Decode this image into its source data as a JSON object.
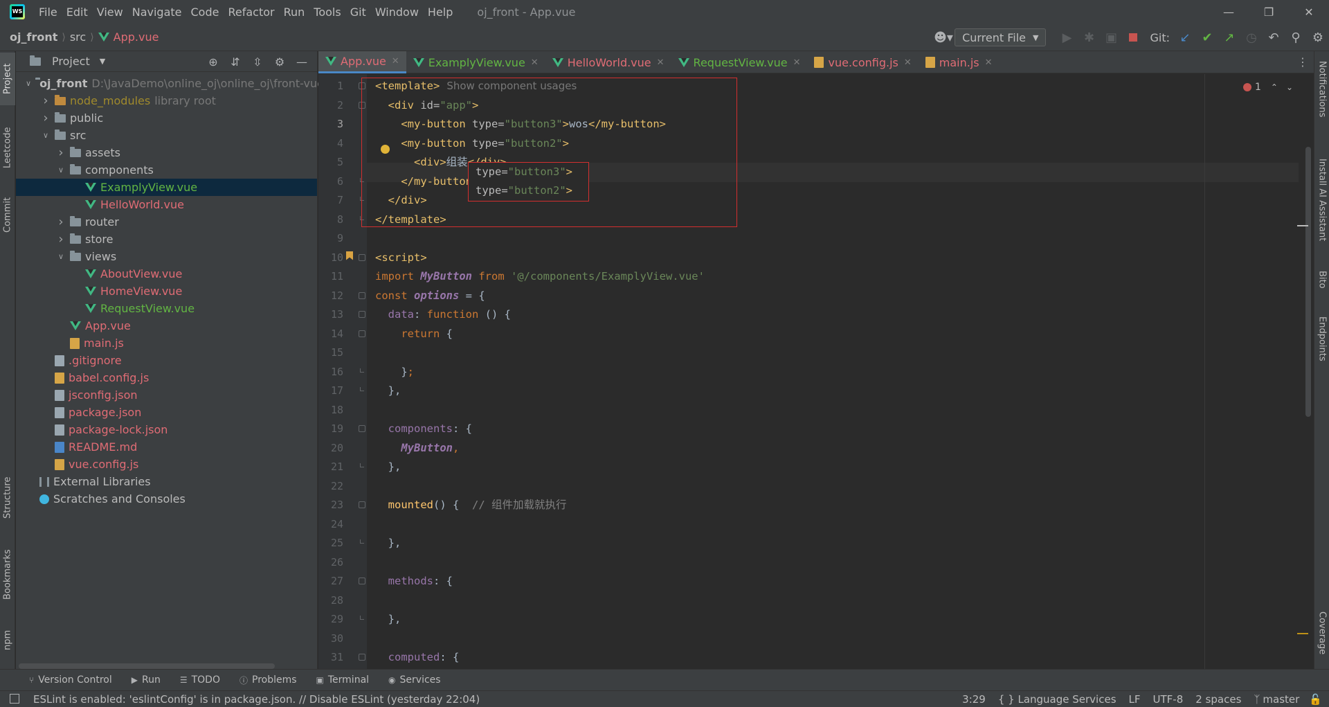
{
  "menubar": {
    "items": [
      "File",
      "Edit",
      "View",
      "Navigate",
      "Code",
      "Refactor",
      "Run",
      "Tools",
      "Git",
      "Window",
      "Help"
    ],
    "window_title": "oj_front - App.vue"
  },
  "navbar": {
    "project": "oj_front",
    "folder": "src",
    "file": "App.vue",
    "run_config": "Current File",
    "git_label": "Git:"
  },
  "left_tool_windows": [
    "Project",
    "Leetcode",
    "Commit",
    "Structure",
    "Bookmarks",
    "npm"
  ],
  "right_tool_windows": [
    "Notifications",
    "Install AI Assistant",
    "Bito",
    "Endpoints",
    "Coverage"
  ],
  "project_panel": {
    "title": "Project",
    "tree": [
      {
        "indent": 0,
        "arrow": "down",
        "icon": "folder",
        "label": "oj_front",
        "hint": "D:\\JavaDemo\\online_oj\\online_oj\\front-vue",
        "color": "bold"
      },
      {
        "indent": 1,
        "arrow": "right",
        "icon": "folder-nm",
        "label": "node_modules",
        "hint": "library root",
        "color": "olive"
      },
      {
        "indent": 1,
        "arrow": "right",
        "icon": "folder",
        "label": "public",
        "hint": "",
        "color": "normal"
      },
      {
        "indent": 1,
        "arrow": "down",
        "icon": "folder",
        "label": "src",
        "hint": "",
        "color": "normal"
      },
      {
        "indent": 2,
        "arrow": "right",
        "icon": "folder",
        "label": "assets",
        "hint": "",
        "color": "normal"
      },
      {
        "indent": 2,
        "arrow": "down",
        "icon": "folder",
        "label": "components",
        "hint": "",
        "color": "normal"
      },
      {
        "indent": 3,
        "arrow": "",
        "icon": "vue",
        "label": "ExamplyView.vue",
        "hint": "",
        "color": "green",
        "selected": true
      },
      {
        "indent": 3,
        "arrow": "",
        "icon": "vue",
        "label": "HelloWorld.vue",
        "hint": "",
        "color": "red"
      },
      {
        "indent": 2,
        "arrow": "right",
        "icon": "folder",
        "label": "router",
        "hint": "",
        "color": "normal"
      },
      {
        "indent": 2,
        "arrow": "right",
        "icon": "folder",
        "label": "store",
        "hint": "",
        "color": "normal"
      },
      {
        "indent": 2,
        "arrow": "down",
        "icon": "folder",
        "label": "views",
        "hint": "",
        "color": "normal"
      },
      {
        "indent": 3,
        "arrow": "",
        "icon": "vue",
        "label": "AboutView.vue",
        "hint": "",
        "color": "red"
      },
      {
        "indent": 3,
        "arrow": "",
        "icon": "vue",
        "label": "HomeView.vue",
        "hint": "",
        "color": "red"
      },
      {
        "indent": 3,
        "arrow": "",
        "icon": "vue",
        "label": "RequestView.vue",
        "hint": "",
        "color": "green"
      },
      {
        "indent": 2,
        "arrow": "",
        "icon": "vue",
        "label": "App.vue",
        "hint": "",
        "color": "red"
      },
      {
        "indent": 2,
        "arrow": "",
        "icon": "js",
        "label": "main.js",
        "hint": "",
        "color": "red"
      },
      {
        "indent": 1,
        "arrow": "",
        "icon": "file",
        "label": ".gitignore",
        "hint": "",
        "color": "red"
      },
      {
        "indent": 1,
        "arrow": "",
        "icon": "js",
        "label": "babel.config.js",
        "hint": "",
        "color": "red"
      },
      {
        "indent": 1,
        "arrow": "",
        "icon": "json",
        "label": "jsconfig.json",
        "hint": "",
        "color": "red"
      },
      {
        "indent": 1,
        "arrow": "",
        "icon": "json",
        "label": "package.json",
        "hint": "",
        "color": "red"
      },
      {
        "indent": 1,
        "arrow": "",
        "icon": "json",
        "label": "package-lock.json",
        "hint": "",
        "color": "red"
      },
      {
        "indent": 1,
        "arrow": "",
        "icon": "md",
        "label": "README.md",
        "hint": "",
        "color": "red"
      },
      {
        "indent": 1,
        "arrow": "",
        "icon": "js",
        "label": "vue.config.js",
        "hint": "",
        "color": "red"
      },
      {
        "indent": 0,
        "arrow": "",
        "icon": "libs",
        "label": "External Libraries",
        "hint": "",
        "color": "normal"
      },
      {
        "indent": 0,
        "arrow": "",
        "icon": "scratch",
        "label": "Scratches and Consoles",
        "hint": "",
        "color": "normal"
      }
    ]
  },
  "tabs": [
    {
      "label": "App.vue",
      "icon": "vue",
      "color": "red",
      "active": true
    },
    {
      "label": "ExamplyView.vue",
      "icon": "vue",
      "color": "green",
      "active": false
    },
    {
      "label": "HelloWorld.vue",
      "icon": "vue",
      "color": "red",
      "active": false
    },
    {
      "label": "RequestView.vue",
      "icon": "vue",
      "color": "green",
      "active": false
    },
    {
      "label": "vue.config.js",
      "icon": "js",
      "color": "red",
      "active": false
    },
    {
      "label": "main.js",
      "icon": "js",
      "color": "red",
      "active": false
    }
  ],
  "editor": {
    "error_count": "1",
    "popup_lines": [
      "type=\"button3\">",
      "type=\"button2\">"
    ],
    "usage_hint": "Show component usages",
    "lines": [
      [
        [
          "t-tag",
          "<template>"
        ]
      ],
      [
        [
          "",
          "  "
        ],
        [
          "t-tag",
          "<div "
        ],
        [
          "t-attr",
          "id="
        ],
        [
          "t-str",
          "\"app\""
        ],
        [
          "t-tag",
          ">"
        ]
      ],
      [
        [
          "",
          "    "
        ],
        [
          "t-tag",
          "<my-button "
        ],
        [
          "t-attr",
          "type="
        ],
        [
          "t-str",
          "\"button3\""
        ],
        [
          "t-tag",
          ">"
        ],
        [
          "",
          "wos"
        ],
        [
          "t-tag",
          "</my-button>"
        ]
      ],
      [
        [
          "",
          "    "
        ],
        [
          "t-tag",
          "<my-button "
        ],
        [
          "t-attr",
          "type="
        ],
        [
          "t-str",
          "\"button2\""
        ],
        [
          "t-tag",
          ">"
        ]
      ],
      [
        [
          "",
          "      "
        ],
        [
          "t-tag",
          "<div>"
        ],
        [
          "",
          "组装"
        ],
        [
          "t-tag",
          "</div>"
        ]
      ],
      [
        [
          "",
          "    "
        ],
        [
          "t-tag",
          "</my-button>"
        ]
      ],
      [
        [
          "",
          "  "
        ],
        [
          "t-tag",
          "</div>"
        ]
      ],
      [
        [
          "t-tag",
          "</template>"
        ]
      ],
      [],
      [
        [
          "t-tag",
          "<script>"
        ]
      ],
      [
        [
          "t-kw",
          "import "
        ],
        [
          "t-cls",
          "MyButton "
        ],
        [
          "t-kw",
          "from "
        ],
        [
          "t-str",
          "'@/components/ExamplyView.vue'"
        ]
      ],
      [
        [
          "t-kw",
          "const "
        ],
        [
          "t-cls",
          "options "
        ],
        [
          "",
          "= {"
        ]
      ],
      [
        [
          "",
          "  "
        ],
        [
          "t-prop",
          "data"
        ],
        [
          "",
          ": "
        ],
        [
          "t-kw",
          "function "
        ],
        [
          "",
          "() {"
        ]
      ],
      [
        [
          "",
          "    "
        ],
        [
          "t-kw",
          "return "
        ],
        [
          "",
          "{"
        ]
      ],
      [],
      [
        [
          "",
          "    "
        ],
        [
          "",
          "}"
        ],
        [
          "t-kw",
          ";"
        ]
      ],
      [
        [
          "",
          "  "
        ],
        [
          "",
          "},"
        ]
      ],
      [],
      [
        [
          "",
          "  "
        ],
        [
          "t-prop",
          "components"
        ],
        [
          "",
          ": {"
        ]
      ],
      [
        [
          "",
          "    "
        ],
        [
          "t-cls",
          "MyButton"
        ],
        [
          "t-kw",
          ","
        ]
      ],
      [
        [
          "",
          "  "
        ],
        [
          "",
          "},"
        ]
      ],
      [],
      [
        [
          "",
          "  "
        ],
        [
          "t-fn",
          "mounted"
        ],
        [
          "",
          "() {  "
        ],
        [
          "t-cmt",
          "// 组件加载就执行"
        ]
      ],
      [],
      [
        [
          "",
          "  "
        ],
        [
          "",
          "},"
        ]
      ],
      [],
      [
        [
          "",
          "  "
        ],
        [
          "t-prop",
          "methods"
        ],
        [
          "",
          ": {"
        ]
      ],
      [],
      [
        [
          "",
          "  "
        ],
        [
          "",
          "},"
        ]
      ],
      [],
      [
        [
          "",
          "  "
        ],
        [
          "t-prop",
          "computed"
        ],
        [
          "",
          ": {"
        ]
      ]
    ]
  },
  "bottom_tools": [
    {
      "label": "Version Control",
      "icon": "branch-icon"
    },
    {
      "label": "Run",
      "icon": "run-icon"
    },
    {
      "label": "TODO",
      "icon": "list-icon"
    },
    {
      "label": "Problems",
      "icon": "problems-icon"
    },
    {
      "label": "Terminal",
      "icon": "terminal-icon"
    },
    {
      "label": "Services",
      "icon": "services-icon"
    }
  ],
  "status": {
    "message": "ESLint is enabled: 'eslintConfig' is in package.json. // Disable ESLint (yesterday 22:04)",
    "position": "3:29",
    "language_services": "{ } Language Services",
    "line_sep": "LF",
    "encoding": "UTF-8",
    "indent": "2 spaces",
    "branch": "master"
  },
  "colors": {
    "background": "#2b2b2b",
    "panel": "#3c3f41",
    "vue_green": "#41b883",
    "modified_red": "#e06c75",
    "added_green": "#62b543",
    "highlight_box": "#d32f2f"
  }
}
